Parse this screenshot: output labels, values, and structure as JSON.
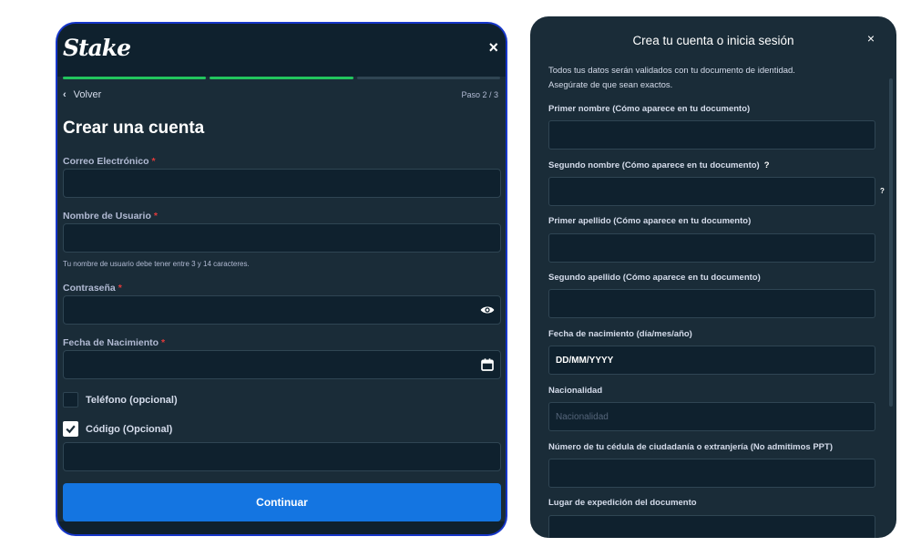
{
  "left": {
    "logo": "Stake",
    "close_icon": "×",
    "back_label": "Volver",
    "step_label": "Paso 2 / 3",
    "title": "Crear una cuenta",
    "required_mark": "*",
    "fields": {
      "email": {
        "label": "Correo Electrónico"
      },
      "username": {
        "label": "Nombre de Usuario",
        "hint": "Tu nombre de usuario debe tener entre 3 y 14 caracteres."
      },
      "password": {
        "label": "Contraseña"
      },
      "birthdate": {
        "label": "Fecha de Nacimiento"
      }
    },
    "phone_option": {
      "label": "Teléfono (opcional)",
      "checked": false
    },
    "code_option": {
      "label": "Código (Opcional)",
      "checked": true
    },
    "continue_label": "Continuar",
    "progress": {
      "total_steps": 3,
      "completed_steps": 2
    },
    "colors": {
      "accent_green": "#22c55e",
      "button_blue": "#1475e1",
      "frame_blue": "#1636c9"
    },
    "icons": [
      "chevron-left-icon",
      "eye-icon",
      "calendar-icon",
      "checkmark-icon",
      "close-icon"
    ]
  },
  "right": {
    "title": "Crea tu cuenta o inicia sesión",
    "close_icon": "×",
    "description_line1": "Todos tus datos serán validados con tu documento de identidad.",
    "description_line2": "Asegúrate de que sean exactos.",
    "help_mark": "?",
    "fields": {
      "first_name": {
        "label": "Primer nombre (Cómo aparece en tu documento)"
      },
      "second_name": {
        "label": "Segundo nombre (Cómo aparece en tu documento)"
      },
      "first_surname": {
        "label": "Primer apellido (Cómo aparece en tu documento)"
      },
      "second_surname": {
        "label": "Segundo apellido (Cómo aparece en tu documento)"
      },
      "birthdate": {
        "label": "Fecha de nacimiento (día/mes/año)",
        "value": "DD/MM/YYYY"
      },
      "nationality": {
        "label": "Nacionalidad",
        "placeholder": "Nacionalidad"
      },
      "id_number": {
        "label": "Número de tu cédula de ciudadanía o extranjería (No admitimos PPT)"
      },
      "issue_place": {
        "label": "Lugar de expedición del documento"
      }
    }
  }
}
